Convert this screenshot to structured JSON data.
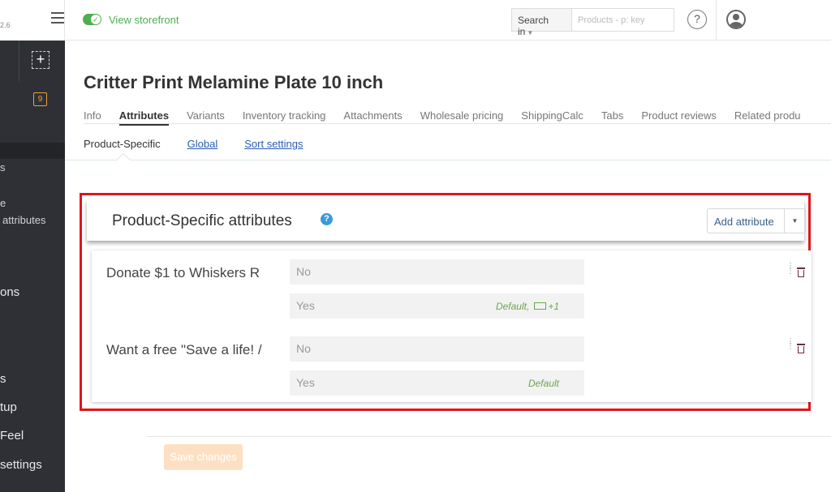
{
  "logo": {
    "version": "2.6"
  },
  "sidebar": {
    "badge_count": "9",
    "items": [
      "s",
      "e",
      "attributes",
      "ons",
      "s",
      "tup",
      "Feel",
      "settings"
    ]
  },
  "header": {
    "storefront_link": "View storefront",
    "search_scope": "Search in",
    "search_placeholder": "Products - p: key",
    "help": "?"
  },
  "page": {
    "title": "Critter Print Melamine Plate 10 inch",
    "tabs": [
      "Info",
      "Attributes",
      "Variants",
      "Inventory tracking",
      "Attachments",
      "Wholesale pricing",
      "ShippingCalc",
      "Tabs",
      "Product reviews",
      "Related produ"
    ],
    "active_tab": "Attributes",
    "subtabs": [
      "Product-Specific",
      "Global",
      "Sort settings"
    ]
  },
  "panel": {
    "title": "Product-Specific attributes",
    "help": "?",
    "add_button": "Add attribute",
    "attributes": [
      {
        "name": "Donate $1 to Whiskers R",
        "options": [
          {
            "value": "No",
            "meta": ""
          },
          {
            "value": "Yes",
            "meta": "Default,",
            "price": "+1"
          }
        ]
      },
      {
        "name": "Want a free \"Save a life! /",
        "options": [
          {
            "value": "No",
            "meta": ""
          },
          {
            "value": "Yes",
            "meta": "Default"
          }
        ]
      }
    ]
  },
  "footer": {
    "save_button": "Save changes"
  },
  "colors": {
    "accent_green": "#4caf50",
    "highlight_red": "#e0151b",
    "sidebar_bg": "#2e3035"
  }
}
